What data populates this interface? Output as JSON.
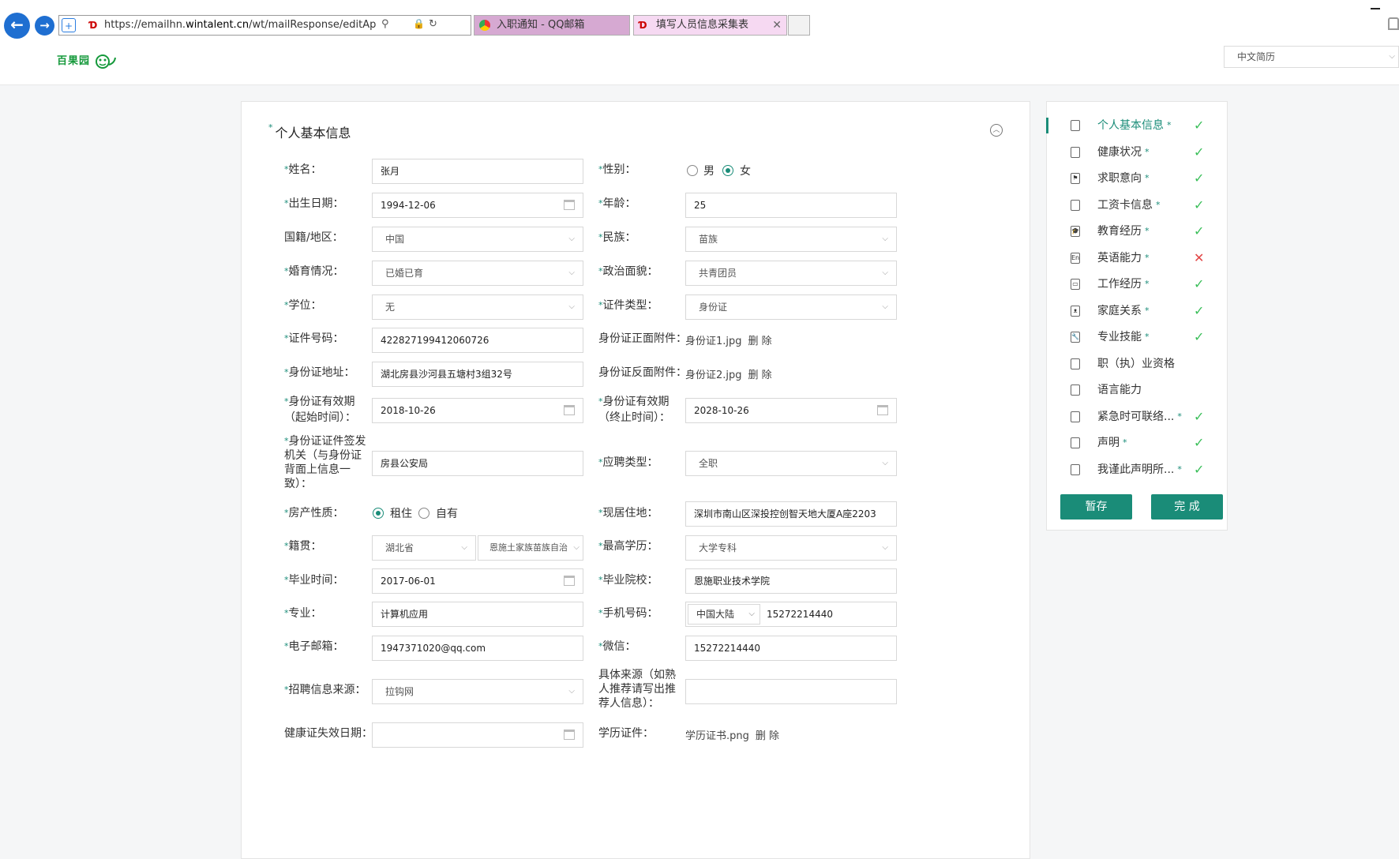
{
  "browser": {
    "url_prefix": "https://emailhn.",
    "url_domain": "wintalent.cn",
    "url_suffix": "/wt/mailResponse/editApplication?recruit",
    "tabs": [
      {
        "label": "入职通知 - QQ邮箱"
      },
      {
        "label": "填写人员信息采集表"
      }
    ],
    "colors": {
      "tab_active": "#f6d9f2",
      "tab_inactive": "#d6a9d2",
      "nav": "#1f6fd1"
    }
  },
  "header": {
    "logo_text": "百果园",
    "lang_select": "中文简历"
  },
  "section": {
    "title": "个人基本信息"
  },
  "form": {
    "name": {
      "label": "姓名：",
      "value": "张月"
    },
    "gender": {
      "label": "性别：",
      "opt_male": "男",
      "opt_female": "女",
      "selected": "女"
    },
    "birth": {
      "label": "出生日期：",
      "value": "1994-12-06"
    },
    "age": {
      "label": "年龄：",
      "value": "25"
    },
    "nationality": {
      "label": "国籍/地区：",
      "value": "中国"
    },
    "ethnicity": {
      "label": "民族：",
      "value": "苗族"
    },
    "marital": {
      "label": "婚育情况：",
      "value": "已婚已育"
    },
    "political": {
      "label": "政治面貌：",
      "value": "共青团员"
    },
    "degree": {
      "label": "学位：",
      "value": "无"
    },
    "id_type": {
      "label": "证件类型：",
      "value": "身份证"
    },
    "id_number": {
      "label": "证件号码：",
      "value": "422827199412060726"
    },
    "id_front": {
      "label": "身份证正面附件：",
      "file": "身份证1.jpg",
      "delete": "删 除"
    },
    "id_address": {
      "label": "身份证地址：",
      "value": "湖北房县沙河县五塘村3组32号"
    },
    "id_back": {
      "label": "身份证反面附件：",
      "file": "身份证2.jpg",
      "delete": "删 除"
    },
    "id_valid_start": {
      "label_line1": "身份证有效期",
      "label_line2": "（起始时间）：",
      "value": "2018-10-26"
    },
    "id_valid_end": {
      "label_line1": "身份证有效期",
      "label_line2": "（终止时间）：",
      "value": "2028-10-26"
    },
    "id_issuer": {
      "label_line1": "身份证证件签发",
      "label_line2": "机关（与身份证",
      "label_line3": "背面上信息一",
      "label_line4": "致）：",
      "value": "房县公安局"
    },
    "job_type": {
      "label": "应聘类型：",
      "value": "全职"
    },
    "housing": {
      "label": "房产性质：",
      "opt_rent": "租住",
      "opt_own": "自有",
      "selected": "租住"
    },
    "current_address": {
      "label": "现居住地：",
      "value": "深圳市南山区深投控创智天地大厦A座2203"
    },
    "native_place": {
      "label": "籍贯：",
      "province": "湖北省",
      "prefecture": "恩施土家族苗族自治"
    },
    "education": {
      "label": "最高学历：",
      "value": "大学专科"
    },
    "graduation": {
      "label": "毕业时间：",
      "value": "2017-06-01"
    },
    "school": {
      "label": "毕业院校：",
      "value": "恩施职业技术学院"
    },
    "major": {
      "label": "专业：",
      "value": "计算机应用"
    },
    "mobile": {
      "label": "手机号码：",
      "region": "中国大陆",
      "value": "15272214440"
    },
    "email": {
      "label": "电子邮箱：",
      "value": "1947371020@qq.com"
    },
    "wechat": {
      "label": "微信：",
      "value": "15272214440"
    },
    "source": {
      "label": "招聘信息来源：",
      "value": "拉钩网"
    },
    "source_detail": {
      "label_line1": "具体来源（如熟",
      "label_line2": "人推荐请写出推",
      "label_line3": "荐人信息）：",
      "value": ""
    },
    "health_expiry": {
      "label": "健康证失效日期：",
      "value": ""
    },
    "edu_cert": {
      "label": "学历证件：",
      "file": "学历证书.png",
      "delete": "删 除"
    }
  },
  "sidebar": {
    "items": [
      {
        "label": "个人基本信息",
        "icon": "form-icon",
        "required": "*",
        "status": "✓"
      },
      {
        "label": "健康状况",
        "icon": "form-icon",
        "required": "*",
        "status": "✓"
      },
      {
        "label": "求职意向",
        "icon": "flag-icon",
        "required": "*",
        "status": "✓"
      },
      {
        "label": "工资卡信息",
        "icon": "form-icon",
        "required": "*",
        "status": "✓"
      },
      {
        "label": "教育经历",
        "icon": "graduation-cap-icon",
        "required": "*",
        "status": "✓"
      },
      {
        "label": "英语能力",
        "icon": "english-icon",
        "required": "*",
        "status": "✕"
      },
      {
        "label": "工作经历",
        "icon": "briefcase-icon",
        "required": "*",
        "status": "✓"
      },
      {
        "label": "家庭关系",
        "icon": "family-icon",
        "required": "*",
        "status": "✓"
      },
      {
        "label": "专业技能",
        "icon": "wrench-icon",
        "required": "*",
        "status": "✓"
      },
      {
        "label": "职（执）业资格",
        "icon": "form-icon",
        "required": "",
        "status": ""
      },
      {
        "label": "语言能力",
        "icon": "form-icon",
        "required": "",
        "status": ""
      },
      {
        "label": "紧急时可联络...",
        "icon": "form-icon",
        "required": "*",
        "status": "✓"
      },
      {
        "label": "声明",
        "icon": "form-icon",
        "required": "*",
        "status": "✓"
      },
      {
        "label": "我谨此声明所...",
        "icon": "form-icon",
        "required": "*",
        "status": "✓"
      }
    ],
    "save_label": "暂存",
    "finish_label": "完 成",
    "colors": {
      "accent": "#1a8c78",
      "ok": "#3bbf5a",
      "error": "#e24545"
    }
  }
}
